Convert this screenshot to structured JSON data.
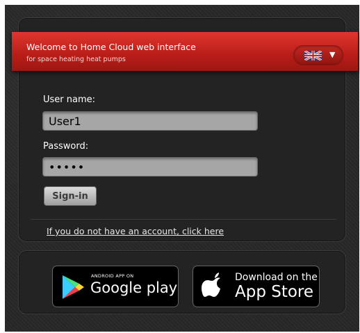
{
  "banner": {
    "title": "Welcome to Home Cloud web interface",
    "subtitle": "for space heating heat pumps",
    "language_icon": "uk-flag-icon"
  },
  "login": {
    "username_label": "User name:",
    "username_value": "User1",
    "password_label": "Password:",
    "password_value": "•••••",
    "signin_label": "Sign-in",
    "register_link": "If you do not have an account, click here"
  },
  "stores": {
    "google_small": "ANDROID APP ON",
    "google_big": "Google play",
    "apple_small": "Download on the",
    "apple_big": "App Store"
  },
  "colors": {
    "banner_red": "#c62720",
    "background": "#2a2a2a",
    "field_gray": "#a6a6a6"
  }
}
